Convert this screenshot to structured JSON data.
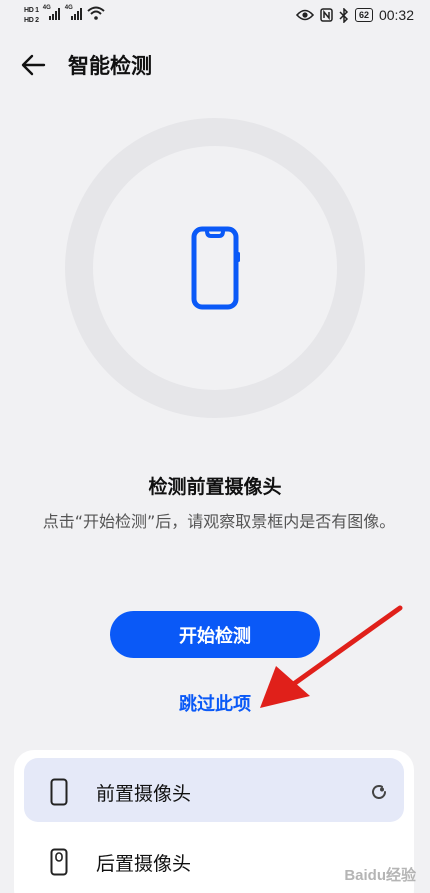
{
  "status_bar": {
    "hd1": "HD 1",
    "hd2": "HD 2",
    "net1": "4G",
    "net2": "4G",
    "battery": "62",
    "time": "00:32"
  },
  "header": {
    "title": "智能检测"
  },
  "main": {
    "heading": "检测前置摄像头",
    "description": "点击“开始检测”后，请观察取景框内是否有图像。",
    "start_button": "开始检测",
    "skip_link": "跳过此项"
  },
  "list": {
    "items": [
      {
        "label": "前置摄像头",
        "icon": "front-phone-icon",
        "status_icon": "loading-icon",
        "active": true
      },
      {
        "label": "后置摄像头",
        "icon": "rear-camera-phone-icon",
        "active": false
      }
    ]
  },
  "colors": {
    "accent": "#0a59f7",
    "annotation_arrow": "#e0201a"
  },
  "watermark": "Baidu经验"
}
